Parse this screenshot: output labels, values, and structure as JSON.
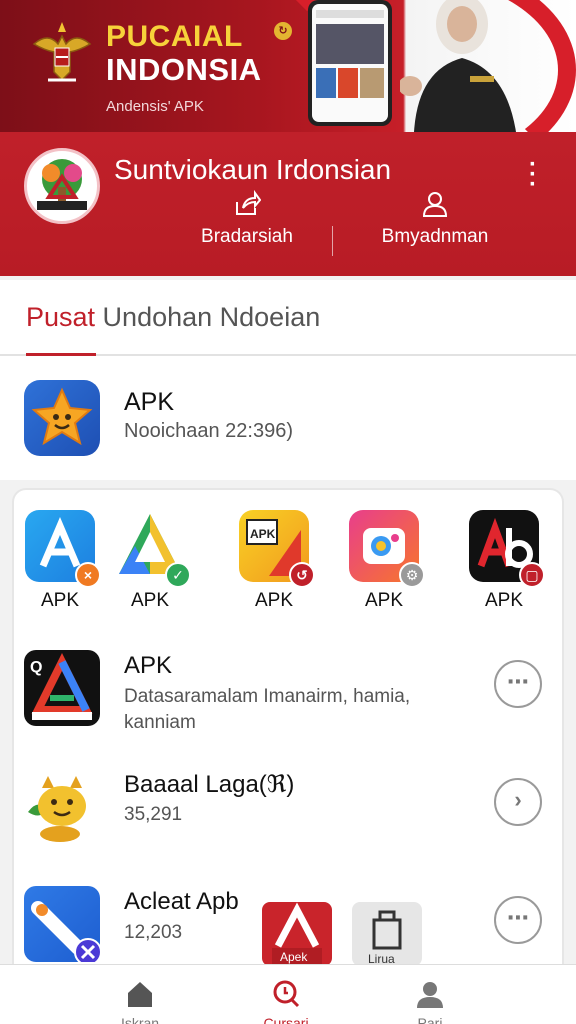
{
  "banner": {
    "title_line1": "PUCAIAL",
    "title_line2": "INDONSIA",
    "subtitle": "Andensis' APK",
    "badge_icon": "refresh-badge-icon"
  },
  "profile": {
    "name": "Suntviokaun Irdonsian",
    "actions": [
      {
        "label": "Bradarsiah",
        "icon": "share-icon"
      },
      {
        "label": "Bmyadnman",
        "icon": "user-icon"
      }
    ]
  },
  "section": {
    "title_highlight": "Pusat",
    "title_rest": " Undohan Ndoeian"
  },
  "featured": {
    "name": "APK",
    "subtitle": "Nooichaan 22:396)"
  },
  "grid": [
    {
      "label": "APK",
      "icon": "apk-blue-icon",
      "badge": "×"
    },
    {
      "label": "APK",
      "icon": "apk-triangle-icon",
      "badge": "✓"
    },
    {
      "label": "APK",
      "icon": "apk-yellow-icon",
      "badge": "↺"
    },
    {
      "label": "APK",
      "icon": "apk-gradient-icon",
      "badge": "⚙"
    },
    {
      "label": "APK",
      "icon": "apk-black-icon",
      "badge": "▢"
    }
  ],
  "list": [
    {
      "name": "APK",
      "subtitle": "Datasaramalam Imanairm, hamia, kanniam",
      "action": "⋯",
      "icon": "apk-dark-icon"
    },
    {
      "name": "Baaaal Laga(ℜ)",
      "subtitle": "35,291",
      "action": "›",
      "icon": "cat-mascot-icon"
    },
    {
      "name": "Acleat Apb",
      "subtitle": "12,203",
      "action": "⋯",
      "icon": "pen-icon"
    }
  ],
  "floating": [
    {
      "label": "Apek",
      "icon": "apk-red-icon"
    },
    {
      "label": "Lirua",
      "icon": "package-icon"
    }
  ],
  "bottom_nav": [
    {
      "label": "Iskran",
      "icon": "home-icon"
    },
    {
      "label": "Cursari",
      "icon": "search-icon"
    },
    {
      "label": "Pari",
      "icon": "profile-icon"
    }
  ],
  "colors": {
    "brand_red": "#c0202a",
    "banner_dark": "#7d0f18",
    "gold": "#f7d23a"
  }
}
